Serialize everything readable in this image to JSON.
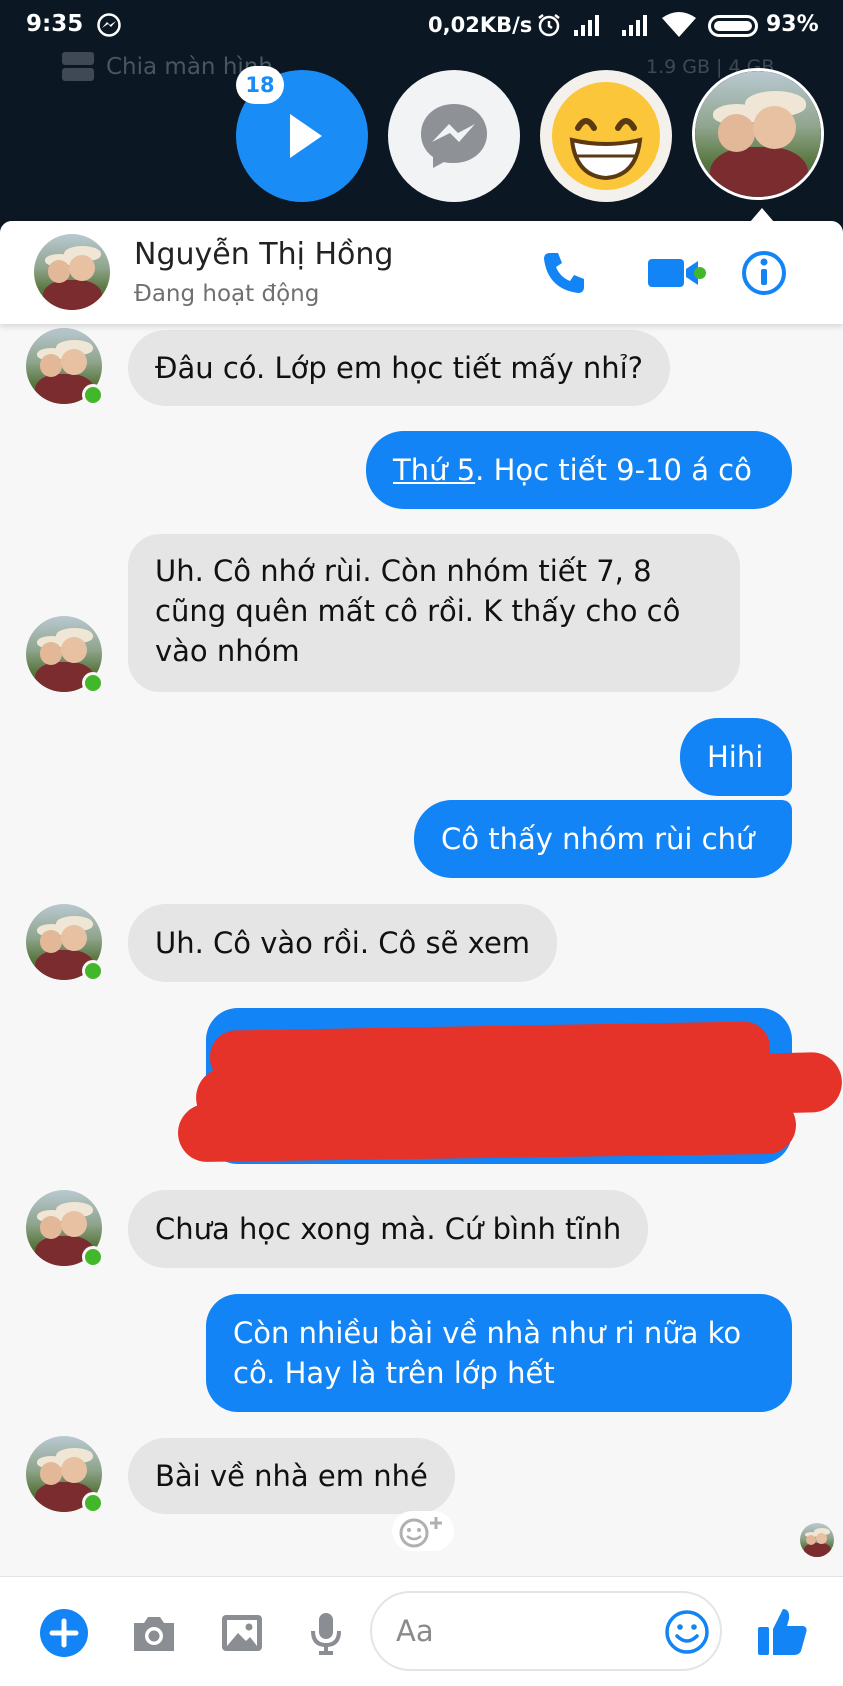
{
  "status": {
    "time": "9:35",
    "network_rate": "0,02KB/s",
    "battery": "93%"
  },
  "background": {
    "split_screen_label": "Chia màn hình",
    "memory": "1.9 GB | 4 GB"
  },
  "chat_heads": {
    "badge_count": "18"
  },
  "header": {
    "name": "Nguyễn Thị Hồng",
    "status": "Đang hoạt động"
  },
  "messages": [
    {
      "side": "in",
      "text": "Đâu có. Lớp em học tiết mấy nhỉ?"
    },
    {
      "side": "out",
      "text_link": "Thứ 5",
      "text": ". Học tiết 9-10 á cô"
    },
    {
      "side": "in",
      "line1": "Uh. Cô nhớ rùi. Còn nhóm tiết 7, 8",
      "line2": "cũng quên mất cô rồi. K thấy cho cô",
      "line3": "vào nhóm"
    },
    {
      "side": "out",
      "text": "Hihi"
    },
    {
      "side": "out",
      "text": "Cô thấy nhóm rùi chứ"
    },
    {
      "side": "in",
      "text": "Uh. Cô vào rồi. Cô sẽ xem"
    },
    {
      "side": "out",
      "text": "",
      "redacted": true
    },
    {
      "side": "in",
      "text": "Chưa học xong mà. Cứ bình tĩnh"
    },
    {
      "side": "out",
      "line1": "Còn nhiều bài về nhà như ri nữa ko",
      "line2": "cô. Hay là trên lớp hết"
    },
    {
      "side": "in",
      "text": "Bài về nhà em nhé"
    }
  ],
  "composer": {
    "placeholder": "Aa"
  },
  "colors": {
    "messenger_blue": "#1284f5",
    "incoming_bubble": "#e5e5e5",
    "online_green": "#42b72a",
    "redaction": "#e5332a"
  }
}
